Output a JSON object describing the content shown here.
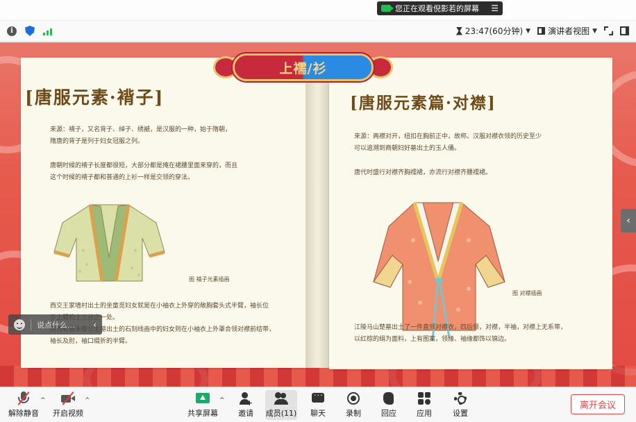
{
  "share_banner": {
    "text": "您正在观看倪影若的屏幕",
    "menu_glyph": "☰"
  },
  "status_bar": {
    "timer": "23:47(60分钟)",
    "view_mode": "演讲者视图"
  },
  "slide": {
    "banner_title": "上襦/衫",
    "left": {
      "heading": "[唐服元素·褙子]",
      "para1": [
        "来源：褙子，又名背子、绰子、绣褫，是汉服的一种，始于隋朝，",
        "隋唐的背子是列于妇女冠服之列。"
      ],
      "para2": [
        "唐朝时候的褙子长度都很短，大部分都是掩在裙腰里面来穿的，而且",
        "这个时候的褙子都和普通的上衫一样是交领的穿法。"
      ],
      "caption": "图  褙子元素插画",
      "para3": [
        "西交王家墙村出土的坐童觅妇女就是在小袖衣上外穿的敞胸套头式半臂，袖长位",
        "于上臂的上三分之一处。",
        "陕西乾县永泰公主墓出土的石刻线画中的妇女则在小袖衣上外罩合领对襟前结带，",
        "袖长及肘，袖口缀折的半臂。"
      ]
    },
    "right": {
      "heading": "[唐服元素篇·对襟]",
      "para1": [
        "来源：两襟对开，纽扣在胸前正中，故称。汉服对襟衣领的历史至少",
        "可以追溯到商朝妇好墓出土的玉人俑。"
      ],
      "para2": [
        "唐代时盛行对襟齐胸襦裙，亦流行对襟齐腰襦裙。"
      ],
      "caption": "图  对襟插画",
      "para3": [
        "江陵马山楚墓出土了一件直领对襟衣，四后领，对襟，半袖，对襟上无系带，",
        "以红棕的绢为面料，上有图案，领缘、袖缘都饰以锦边。"
      ]
    },
    "side_arrow": "‹"
  },
  "chat_input": {
    "placeholder": "说点什么...",
    "chevron": "‹"
  },
  "toolbar": {
    "unmute": "解除静音",
    "start_video": "开启视频",
    "share_screen": "共享屏幕",
    "invite": "邀请",
    "members": "成员(11)",
    "chat": "聊天",
    "record": "录制",
    "reaction": "回应",
    "apps": "应用",
    "settings": "设置",
    "leave": "离开会议"
  },
  "colors": {
    "accent_green": "#1fbf52",
    "leave_red": "#e64545",
    "slide_red": "#e34a43",
    "heading_brown": "#6e4a18"
  }
}
